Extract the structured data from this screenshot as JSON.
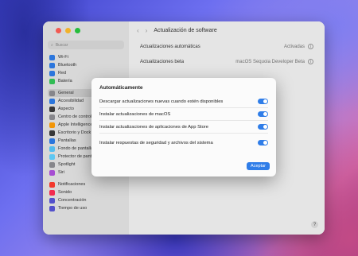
{
  "window": {
    "title": "Actualización de software",
    "search_placeholder": "Buscar",
    "sidebar": [
      {
        "label": "Wi-Fi",
        "color": "#2f7de8"
      },
      {
        "label": "Bluetooth",
        "color": "#2f7de8"
      },
      {
        "label": "Red",
        "color": "#2f7de8"
      },
      {
        "label": "Batería",
        "color": "#34c759"
      },
      {
        "gap": true
      },
      {
        "label": "General",
        "color": "#8e8e93",
        "selected": true
      },
      {
        "label": "Accesibilidad",
        "color": "#2f7de8"
      },
      {
        "label": "Aspecto",
        "color": "#3a3a3c"
      },
      {
        "label": "Centro de control",
        "color": "#8e8e93"
      },
      {
        "label": "Apple Intelligence",
        "color": "#ff9f0a"
      },
      {
        "label": "Escritorio y Dock",
        "color": "#3a3a3c"
      },
      {
        "label": "Pantallas",
        "color": "#2f7de8"
      },
      {
        "label": "Fondo de pantalla",
        "color": "#5ac8fa"
      },
      {
        "label": "Protector de pantalla",
        "color": "#64d2ff"
      },
      {
        "label": "Spotlight",
        "color": "#8e8e93"
      },
      {
        "label": "Siri",
        "color": "#af52de"
      },
      {
        "gap": true
      },
      {
        "label": "Notificaciones",
        "color": "#ff3b30"
      },
      {
        "label": "Sonido",
        "color": "#ff2d55"
      },
      {
        "label": "Concentración",
        "color": "#5856d6"
      },
      {
        "label": "Tiempo de uso",
        "color": "#5856d6"
      }
    ],
    "rows": [
      {
        "label": "Actualizaciones automáticas",
        "value": "Activadas"
      },
      {
        "label": "Actualizaciones beta",
        "value": "macOS Sequoia Developer Beta"
      }
    ],
    "help_label": "?"
  },
  "dialog": {
    "title": "Automáticamente",
    "options": [
      {
        "label": "Descargar actualizaciones nuevas cuando estén disponibles",
        "on": true
      },
      {
        "label": "Instalar actualizaciones de macOS",
        "on": true
      },
      {
        "label": "Instalar actualizaciones de aplicaciones de App Store",
        "on": true
      },
      {
        "label": "Instalar respuestas de seguridad y archivos del sistema",
        "on": true
      }
    ],
    "accept_label": "Aceptar"
  },
  "colors": {
    "accent": "#2f7de8"
  }
}
